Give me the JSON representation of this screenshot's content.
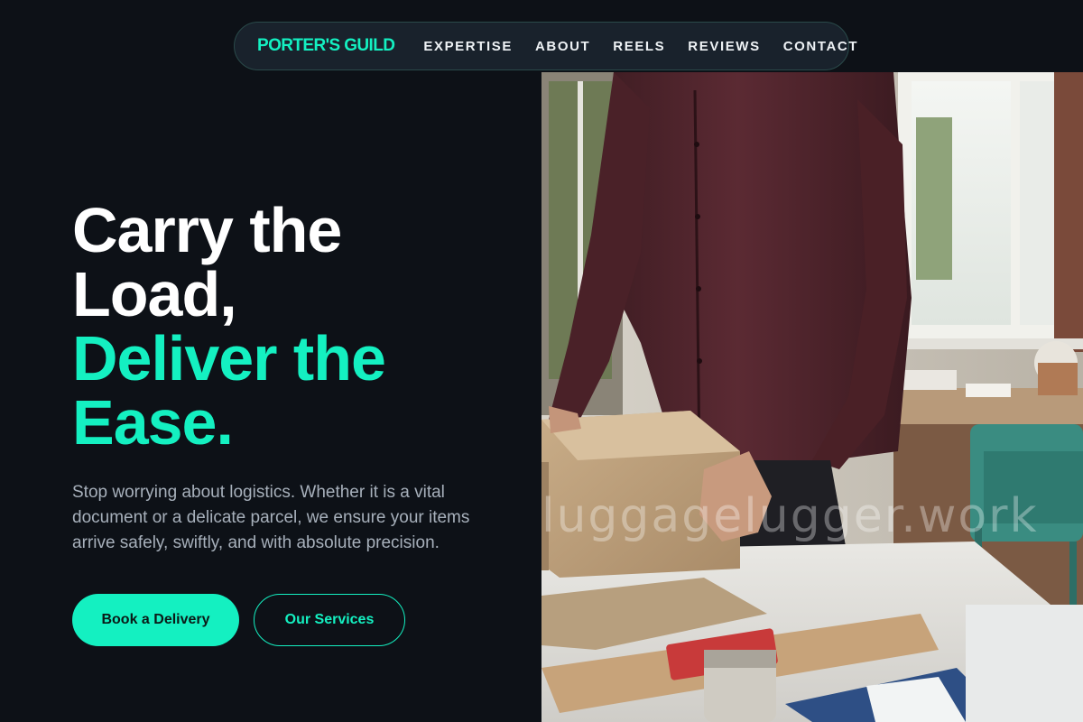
{
  "nav": {
    "logo": "PORTER'S GUILD",
    "links": [
      "EXPERTISE",
      "ABOUT",
      "REELS",
      "REVIEWS",
      "CONTACT"
    ]
  },
  "hero": {
    "headline_line1": "Carry the",
    "headline_line2": "Load,",
    "headline_accent_line1": "Deliver the",
    "headline_accent_line2": "Ease.",
    "subtext": "Stop worrying about logistics. Whether it is a vital document or a delicate parcel, we ensure your items arrive safely, swiftly, and with absolute precision.",
    "primary_cta": "Book a Delivery",
    "secondary_cta": "Our Services"
  },
  "image": {
    "watermark": "luggagelugger.work"
  },
  "colors": {
    "accent": "#14f0c1",
    "background": "#0d1117",
    "nav_background": "#19222c",
    "body_text": "#a7b0bb"
  }
}
